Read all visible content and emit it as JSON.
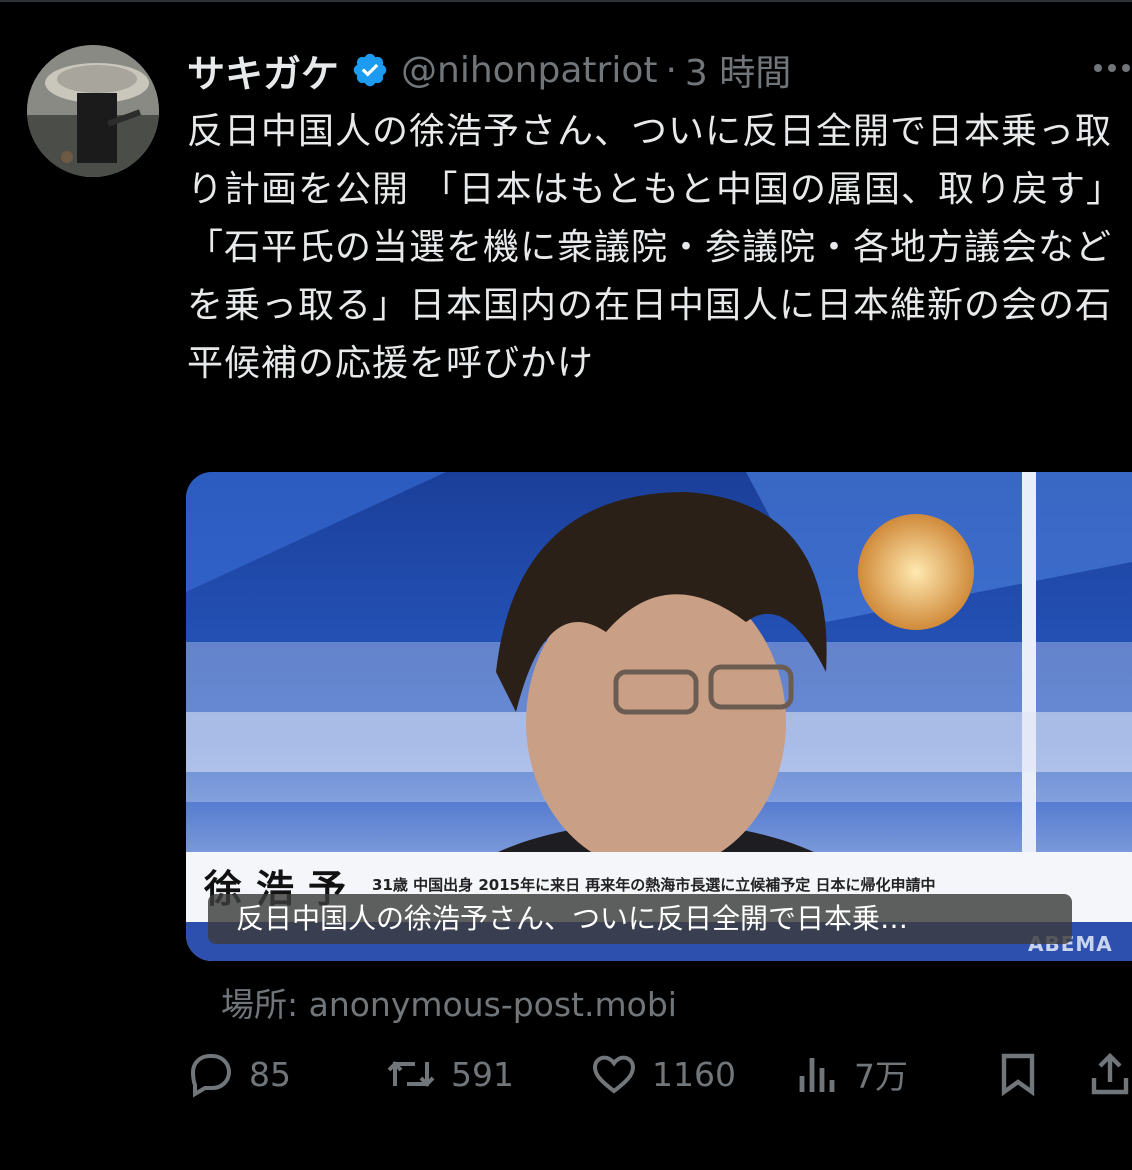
{
  "tweet": {
    "display_name": "サキガケ",
    "handle": "@nihonpatriot",
    "separator": "·",
    "time": "3 時間",
    "text": "反日中国人の徐浩予さん、ついに反日全開で日本乗っ取り計画を公開 「日本はもともと中国の属国、取り戻す」「石平氏の当選を機に衆議院・参議院・各地方議会などを乗っ取る」日本国内の在日中国人に日本維新の会の石平候補の応援を呼びかけ"
  },
  "media": {
    "tv_name": "徐浩予",
    "tv_subtitle": "31歳 中国出身 2015年に来日 再来年の熱海市長選に立候補予定 日本に帰化申請中",
    "tv_logo": "ABEMA",
    "caption": "反日中国人の徐浩予さん、ついに反日全開で日本乗…"
  },
  "location": "場所: anonymous-post.mobi",
  "actions": {
    "replies": "85",
    "reposts": "591",
    "likes": "1160",
    "views": "7万"
  },
  "colors": {
    "background": "#000000",
    "text": "#e7e9ea",
    "muted": "#71767b",
    "verified": "#1d9bf0"
  },
  "icons": [
    "verified-badge-icon",
    "more-icon",
    "reply-icon",
    "repost-icon",
    "like-icon",
    "views-icon",
    "bookmark-icon",
    "share-icon"
  ]
}
